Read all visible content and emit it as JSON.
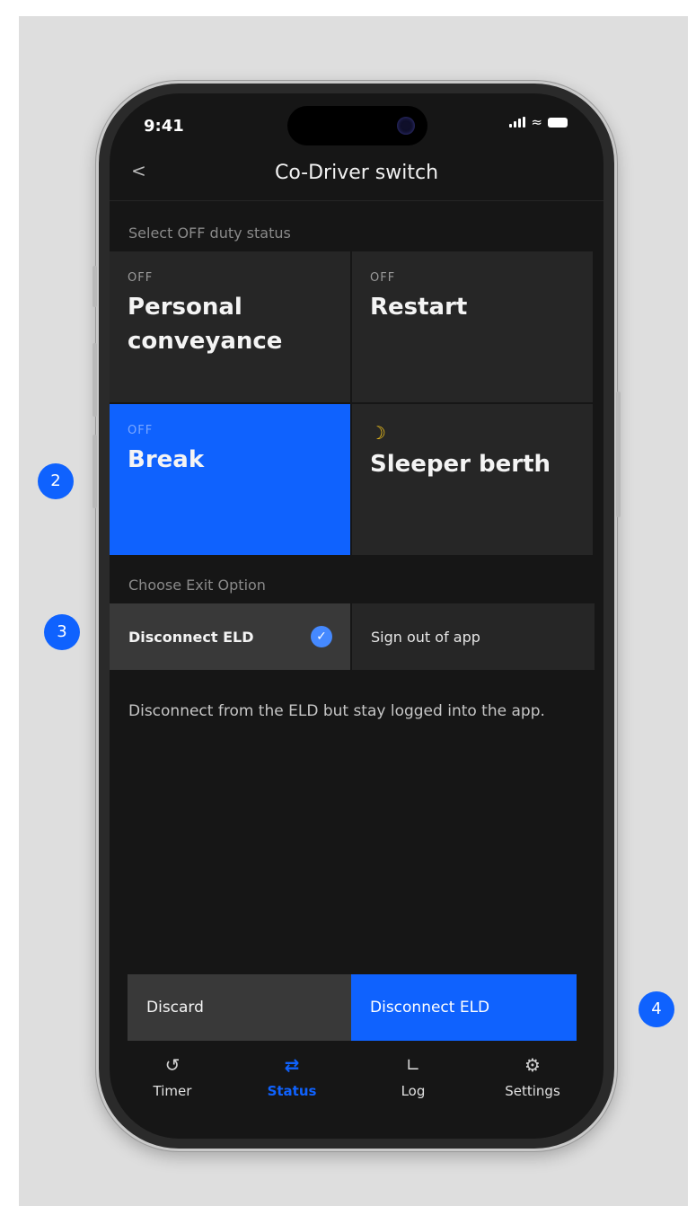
{
  "statusbar": {
    "time": "9:41"
  },
  "nav": {
    "back": "<",
    "title": "Co-Driver switch"
  },
  "off_duty": {
    "label": "Select OFF duty status",
    "tiles": [
      {
        "prefix": "OFF",
        "title": "Personal conveyance",
        "selected": false
      },
      {
        "prefix": "OFF",
        "title": "Restart",
        "selected": false
      },
      {
        "prefix": "OFF",
        "title": "Break",
        "selected": true
      },
      {
        "icon": "moon-icon",
        "title": "Sleeper berth",
        "selected": false
      }
    ]
  },
  "exit": {
    "label": "Choose Exit Option",
    "options": [
      {
        "label": "Disconnect ELD",
        "selected": true
      },
      {
        "label": "Sign out of app",
        "selected": false
      }
    ],
    "description": "Disconnect from the ELD but stay logged into the app."
  },
  "actions": {
    "discard": "Discard",
    "primary": "Disconnect ELD"
  },
  "tabs": [
    {
      "label": "Timer",
      "icon": "history-icon",
      "active": false
    },
    {
      "label": "Status",
      "icon": "switch-icon",
      "active": true
    },
    {
      "label": "Log",
      "icon": "log-chart-icon",
      "active": false
    },
    {
      "label": "Settings",
      "icon": "gear-icon",
      "active": false
    }
  ],
  "markers": [
    "2",
    "3",
    "4"
  ],
  "colors": {
    "accent": "#0f62fe",
    "background": "#161616",
    "moon": "#f1c21b"
  }
}
